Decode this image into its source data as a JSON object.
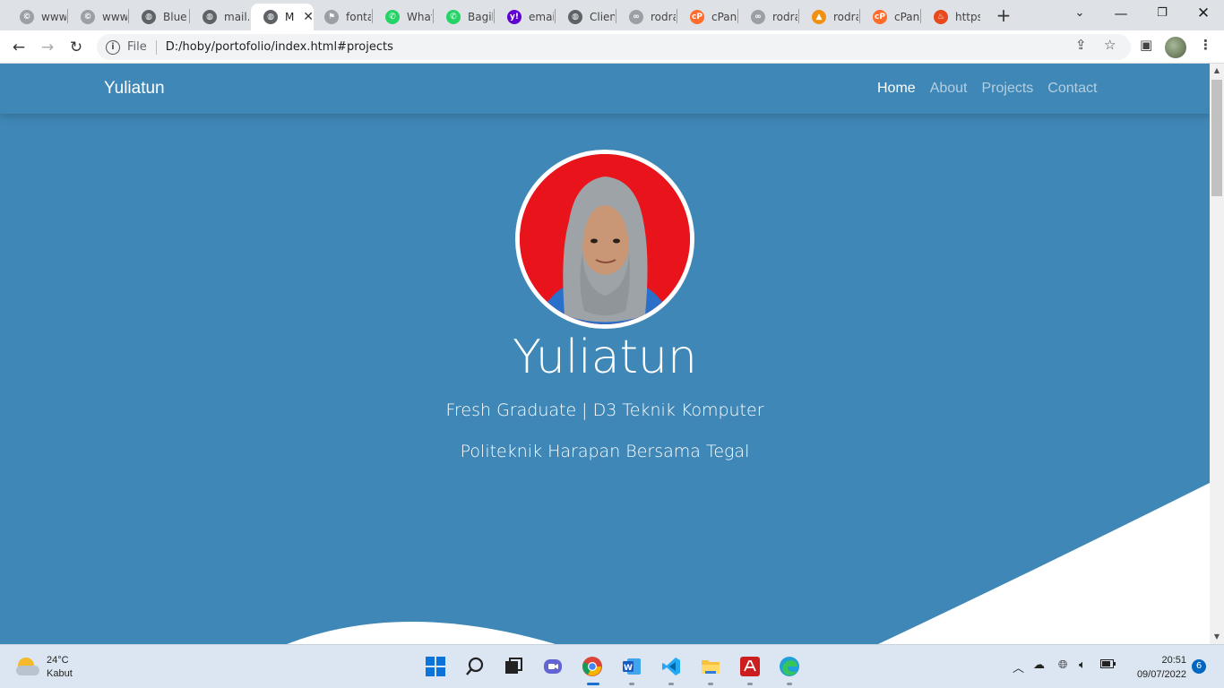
{
  "browser": {
    "tabs": [
      {
        "label": "www.",
        "icon": "copyright-icon",
        "color": "#9aa0a6"
      },
      {
        "label": "www.",
        "icon": "copyright-icon",
        "color": "#9aa0a6"
      },
      {
        "label": "Blue",
        "icon": "globe-icon",
        "color": "#5f6368"
      },
      {
        "label": "mail.",
        "icon": "globe-icon",
        "color": "#5f6368"
      },
      {
        "label": "M",
        "icon": "globe-icon",
        "color": "#5f6368",
        "active": true
      },
      {
        "label": "fonta",
        "icon": "flag-icon",
        "color": "#9aa0a6"
      },
      {
        "label": "What",
        "icon": "whatsapp-icon",
        "color": "#25d366"
      },
      {
        "label": "Bagik",
        "icon": "whatsapp-icon",
        "color": "#25d366"
      },
      {
        "label": "email",
        "icon": "yahoo-icon",
        "color": "#6001d2"
      },
      {
        "label": "Clien",
        "icon": "globe-icon",
        "color": "#5f6368"
      },
      {
        "label": "rodra",
        "icon": "link-icon",
        "color": "#9aa0a6"
      },
      {
        "label": "cPan",
        "icon": "cpanel-icon",
        "color": "#ff6c2c"
      },
      {
        "label": "rodra",
        "icon": "link-icon",
        "color": "#9aa0a6"
      },
      {
        "label": "rodra",
        "icon": "pma-icon",
        "color": "#f29111"
      },
      {
        "label": "cPan",
        "icon": "cpanel-icon",
        "color": "#ff6c2c"
      },
      {
        "label": "https",
        "icon": "fire-icon",
        "color": "#e8491d"
      }
    ],
    "file_label": "File",
    "url": "D:/hoby/portofolio/index.html#projects"
  },
  "site": {
    "brand": "Yuliatun",
    "nav": [
      {
        "label": "Home",
        "active": true
      },
      {
        "label": "About"
      },
      {
        "label": "Projects"
      },
      {
        "label": "Contact"
      }
    ],
    "hero": {
      "name": "Yuliatun",
      "subtitle": "Fresh Graduate | D3 Teknik Komputer",
      "school": "Politeknik Harapan Bersama Tegal"
    },
    "colors": {
      "primary": "#3f87b6",
      "photo_bg": "#e8131b"
    }
  },
  "taskbar": {
    "weather": {
      "temp": "24°C",
      "condition": "Kabut"
    },
    "apps": [
      "windows-start-icon",
      "search-icon",
      "task-view-icon",
      "teams-chat-icon",
      "chrome-icon",
      "word-icon",
      "vscode-icon",
      "file-explorer-icon",
      "acrobat-icon",
      "edge-icon"
    ],
    "time": "20:51",
    "date": "09/07/2022",
    "notifications": "6"
  }
}
